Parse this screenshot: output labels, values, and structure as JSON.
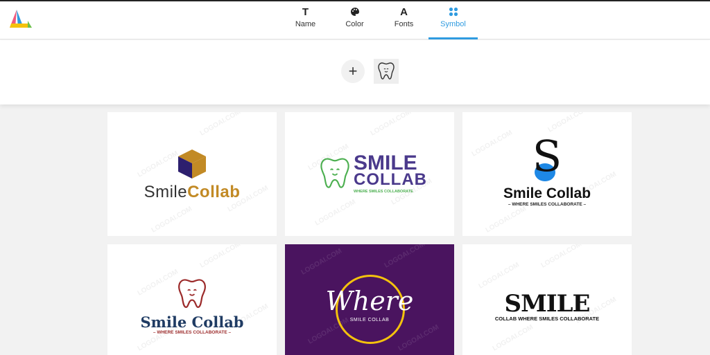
{
  "tabs": [
    {
      "label": "Name",
      "icon": "text-icon"
    },
    {
      "label": "Color",
      "icon": "palette-icon"
    },
    {
      "label": "Fonts",
      "icon": "font-icon"
    },
    {
      "label": "Symbol",
      "icon": "symbol-icon"
    }
  ],
  "active_tab": "Symbol",
  "toolbar": {
    "add_label": "+"
  },
  "watermark": "LOGOAI.COM",
  "cards": [
    {
      "brand_a": "Smile",
      "brand_b": "Collab",
      "colors": {
        "a": "#333333",
        "b": "#c28a25",
        "box_top": "#c28a25",
        "box_side": "#2d1f6e"
      }
    },
    {
      "line1": "SMILE",
      "line2": "COLLAB",
      "tagline": "WHERE SMILES COLLABORATE",
      "colors": {
        "text": "#4b3a8c",
        "tooth": "#4caf50"
      }
    },
    {
      "letter": "S",
      "name": "Smile Collab",
      "tagline": "WHERE SMILES COLLABORATE",
      "colors": {
        "accent": "#1e88e5"
      }
    },
    {
      "name": "Smile Collab",
      "tagline": "WHERE SMILES COLLABORATE",
      "colors": {
        "name": "#1f3b63",
        "tooth": "#9c2b2b",
        "tagline": "#9c2b2b"
      }
    },
    {
      "script": "Where",
      "sub": "SMILE COLLAB",
      "colors": {
        "bg": "#4a145f",
        "ring": "#f4c20d"
      }
    },
    {
      "word": "SMILE",
      "tagline": "COLLAB WHERE SMILES COLLABORATE"
    }
  ]
}
